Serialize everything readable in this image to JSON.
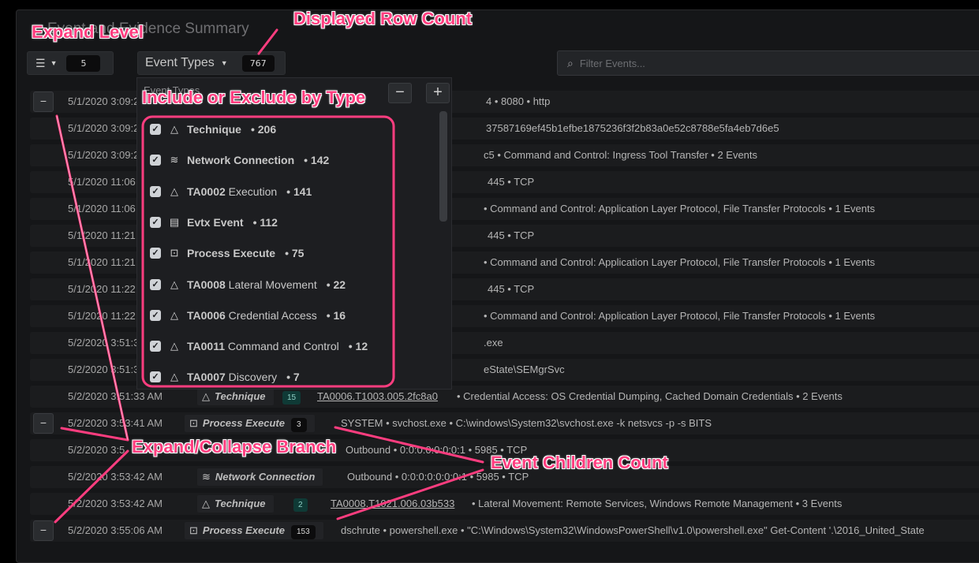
{
  "title": "Event and Evidence Summary",
  "expand_level": "5",
  "event_types_label": "Event Types",
  "row_count": "767",
  "filter_placeholder": "Filter Events...",
  "dropdown": {
    "header": "Event Types",
    "items": [
      {
        "icon": "triangle",
        "bold": "Technique",
        "rest": "",
        "count": "• 206"
      },
      {
        "icon": "wifi",
        "bold": "Network Connection",
        "rest": "",
        "count": "• 142"
      },
      {
        "icon": "triangle",
        "bold": "TA0002",
        "rest": " Execution",
        "count": "• 141"
      },
      {
        "icon": "document",
        "bold": "Evtx Event",
        "rest": "",
        "count": "• 112"
      },
      {
        "icon": "terminal",
        "bold": "Process Execute",
        "rest": "",
        "count": "• 75"
      },
      {
        "icon": "triangle",
        "bold": "TA0008",
        "rest": " Lateral Movement",
        "count": "• 22"
      },
      {
        "icon": "triangle",
        "bold": "TA0006",
        "rest": " Credential Access",
        "count": "• 16"
      },
      {
        "icon": "triangle",
        "bold": "TA0011",
        "rest": " Command and Control",
        "count": "• 12"
      },
      {
        "icon": "triangle",
        "bold": "TA0007",
        "rest": " Discovery",
        "count": "• 7"
      }
    ]
  },
  "rows": [
    {
      "time": "5/1/2020 3:09:2",
      "rest": "4 • 8080 • http"
    },
    {
      "time": "5/1/2020 3:09:2",
      "rest": "37587169ef45b1efbe1875236f3f2b83a0e52c8788e5fa4eb7d6e5"
    },
    {
      "time": "5/1/2020 3:09:2",
      "rest": "c5 • Command and Control: Ingress Tool Transfer • 2 Events"
    },
    {
      "time": "5/1/2020 11:06",
      "rest": "445 • TCP"
    },
    {
      "time": "5/1/2020 11:06",
      "rest": "• Command and Control: Application Layer Protocol, File Transfer Protocols • 1 Events"
    },
    {
      "time": "5/1/2020 11:21",
      "rest": "445 • TCP"
    },
    {
      "time": "5/1/2020 11:21",
      "rest": "• Command and Control: Application Layer Protocol, File Transfer Protocols • 1 Events"
    },
    {
      "time": "5/1/2020 11:22",
      "rest": "445 • TCP"
    },
    {
      "time": "5/1/2020 11:22",
      "rest": "• Command and Control: Application Layer Protocol, File Transfer Protocols • 1 Events"
    },
    {
      "time": "5/2/2020 3:51:3",
      "rest": ".exe"
    },
    {
      "time": "5/2/2020 3:51:3",
      "rest": "eState\\SEMgrSvc"
    },
    {
      "time": "5/2/2020 3:51:33 AM",
      "type": "Technique",
      "tbadge": "15",
      "link": "TA0006.T1003.005.2fc8a0",
      "rest": "• Credential Access: OS Credential Dumping, Cached Domain Credentials • 2 Events"
    },
    {
      "time": "5/2/2020 3:53:41 AM",
      "type": "Process Execute",
      "cbadge": "3",
      "rest": "SYSTEM • svchost.exe • C:\\windows\\System32\\svchost.exe -k netsvcs -p -s BITS"
    },
    {
      "time": "5/2/2020 3:5",
      "rest": "Outbound • 0:0:0:0:0:0:0:1 • 5985 • TCP"
    },
    {
      "time": "5/2/2020 3:53:42 AM",
      "type": "Network Connection",
      "rest": "Outbound • 0:0:0:0:0:0:0:1 • 5985 • TCP"
    },
    {
      "time": "5/2/2020 3:53:42 AM",
      "type": "Technique",
      "tbadge": "2",
      "link": "TA0008.T1021.006.03b533",
      "rest": "• Lateral Movement: Remote Services, Windows Remote Management • 3 Events"
    },
    {
      "time": "5/2/2020 3:55:06 AM",
      "type": "Process Execute",
      "cbadge": "153",
      "rest": "dschrute • powershell.exe • \"C:\\Windows\\System32\\WindowsPowerShell\\v1.0\\powershell.exe\" Get-Content '.\\2016_United_State"
    }
  ],
  "annotations": {
    "expand_level": "Expand Level",
    "row_count": "Displayed Row Count",
    "include_exclude": "Include or Exclude by Type",
    "expand_collapse": "Expand/Collapse Branch",
    "children_count": "Event Children Count"
  },
  "colors": {
    "annotation": "#ff3d7f",
    "background": "#151618",
    "row": "#1b1c1e"
  }
}
